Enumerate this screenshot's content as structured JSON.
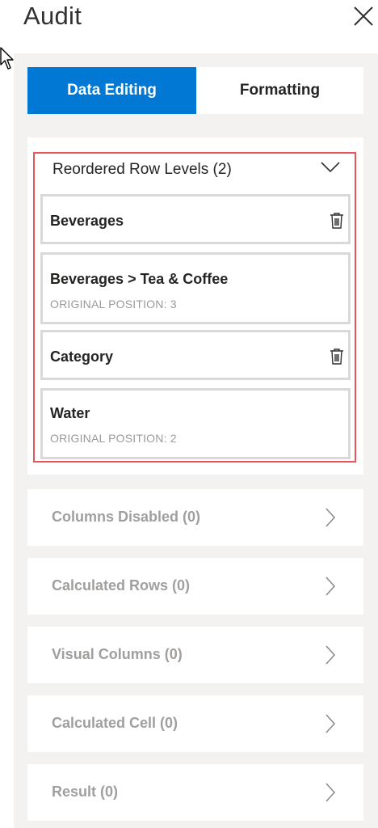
{
  "header": {
    "title": "Audit"
  },
  "tabs": [
    {
      "label": "Data Editing",
      "active": true
    },
    {
      "label": "Formatting",
      "active": false
    }
  ],
  "reordered": {
    "header": "Reordered Row Levels (2)",
    "items": [
      {
        "name": "Beverages",
        "sub": ""
      },
      {
        "name": "Beverages > Tea & Coffee",
        "sub": "ORIGINAL POSITION: 3"
      },
      {
        "name": "Category",
        "sub": ""
      },
      {
        "name": "Water",
        "sub": "ORIGINAL POSITION: 2"
      }
    ]
  },
  "sections": [
    {
      "label": "Columns Disabled (0)"
    },
    {
      "label": "Calculated Rows (0)"
    },
    {
      "label": "Visual Columns (0)"
    },
    {
      "label": "Calculated Cell (0)"
    },
    {
      "label": "Result (0)"
    }
  ],
  "colors": {
    "accent": "#0078d4",
    "highlight_border": "#e8545a",
    "panel_bg": "#f3f2f1",
    "muted_text": "#a19f9d"
  },
  "icons": [
    "mouse-pointer-icon",
    "close-icon",
    "chevron-down-icon",
    "trash-icon",
    "chevron-right-icon"
  ]
}
